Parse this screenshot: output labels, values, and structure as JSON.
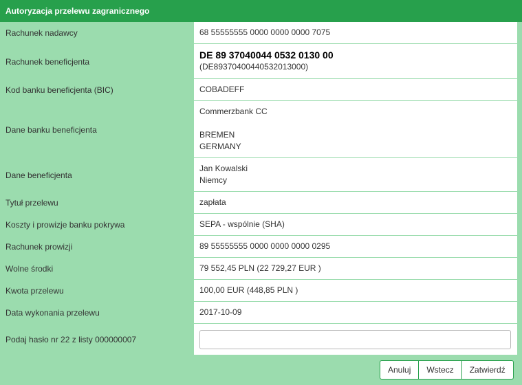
{
  "header": {
    "title": "Autoryzacja przelewu zagranicznego"
  },
  "rows": [
    {
      "label": "Rachunek nadawcy",
      "value": "68 55555555 0000 0000 0000 7075"
    },
    {
      "label": "Rachunek beneficjenta",
      "iban": "DE 89 37040044 0532 0130 00",
      "iban_raw": "(DE89370400440532013000)"
    },
    {
      "label": "Kod banku beneficjenta (BIC)",
      "value": "COBADEFF"
    },
    {
      "label": "Dane banku beneficjenta",
      "lines": [
        "Commerzbank CC",
        "",
        "BREMEN",
        "GERMANY"
      ]
    },
    {
      "label": "Dane beneficjenta",
      "lines": [
        "Jan Kowalski",
        "Niemcy"
      ]
    },
    {
      "label": "Tytuł przelewu",
      "value": "zapłata"
    },
    {
      "label": "Koszty i prowizje banku pokrywa",
      "value": "SEPA - wspólnie (SHA)"
    },
    {
      "label": "Rachunek prowizji",
      "value": "89 55555555 0000 0000 0000 0295"
    },
    {
      "label": "Wolne środki",
      "value": "79 552,45 PLN (22 729,27 EUR )"
    },
    {
      "label": "Kwota przelewu",
      "value": "100,00 EUR (448,85 PLN )"
    },
    {
      "label": "Data wykonania przelewu",
      "value": "2017-10-09"
    },
    {
      "label": "Podaj hasło nr 22 z listy 000000007",
      "input_value": ""
    }
  ],
  "buttons": {
    "cancel": "Anuluj",
    "back": "Wstecz",
    "confirm": "Zatwierdź"
  },
  "colors": {
    "header_bg": "#27a04c",
    "panel_bg": "#9bdcae",
    "value_bg": "#ffffff"
  }
}
